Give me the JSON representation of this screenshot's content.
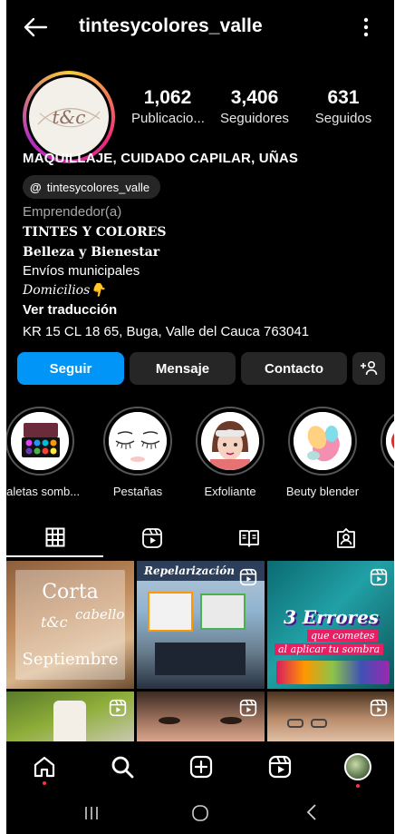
{
  "header": {
    "username": "tintesycolores_valle"
  },
  "profile": {
    "avatar_text": "t&c",
    "stats": [
      {
        "value": "1,062",
        "label": "Publicacio..."
      },
      {
        "value": "3,406",
        "label": "Seguidores"
      },
      {
        "value": "631",
        "label": "Seguidos"
      }
    ],
    "category": "MAQUILLAJE, CUIDADO CAPILAR, UÑAS",
    "threads_handle": "tintesycolores_valle",
    "threads_icon": "@",
    "bio": {
      "role": "Emprendedor(a)",
      "name": "TINTES Y COLORES",
      "tagline": "Belleza y Bienestar",
      "line1": "Envíos municipales",
      "line2": "Domicilios👇",
      "translate": "Ver traducción",
      "address": "KR 15 CL 18 65, Buga, Valle del Cauca 763041"
    }
  },
  "actions": {
    "follow": "Seguir",
    "message": "Mensaje",
    "contact": "Contacto"
  },
  "highlights": [
    {
      "label": "paletas somb..."
    },
    {
      "label": "Pestañas"
    },
    {
      "label": "Exfoliante"
    },
    {
      "label": "Beuty blender"
    }
  ],
  "posts": {
    "p1": {
      "line1": "Corta",
      "brand": "t&c",
      "word": "cabello",
      "line3": "Septiembre"
    },
    "p2": {
      "title": "Repelarización"
    },
    "p3": {
      "big": "3 Errores",
      "sub1": "que cometes",
      "sub2": "al aplicar tu sombra"
    }
  },
  "colors": {
    "follow": "#0095f6",
    "button": "#262626",
    "badge": "#ff3040"
  }
}
